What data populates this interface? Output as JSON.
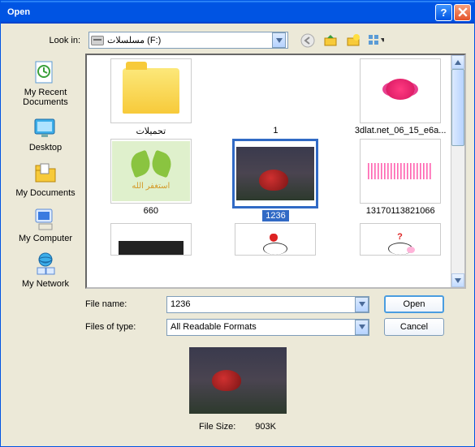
{
  "window": {
    "title": "Open"
  },
  "lookin": {
    "label": "Look in:",
    "value": "مسلسلات (F:)"
  },
  "sidebar": {
    "items": [
      {
        "label": "My Recent Documents"
      },
      {
        "label": "Desktop"
      },
      {
        "label": "My Documents"
      },
      {
        "label": "My Computer"
      },
      {
        "label": "My Network"
      }
    ]
  },
  "files": {
    "items": [
      {
        "name": "تحميلات"
      },
      {
        "name": "1"
      },
      {
        "name": "3dlat.net_06_15_e6a..."
      },
      {
        "name": "660"
      },
      {
        "name": "1236"
      },
      {
        "name": "13170113821066"
      }
    ],
    "selected": "1236"
  },
  "filename": {
    "label": "File name:",
    "value": "1236"
  },
  "filetype": {
    "label": "Files of type:",
    "value": "All Readable Formats"
  },
  "buttons": {
    "open": "Open",
    "cancel": "Cancel"
  },
  "filesize": {
    "label": "File Size:",
    "value": "903K"
  }
}
